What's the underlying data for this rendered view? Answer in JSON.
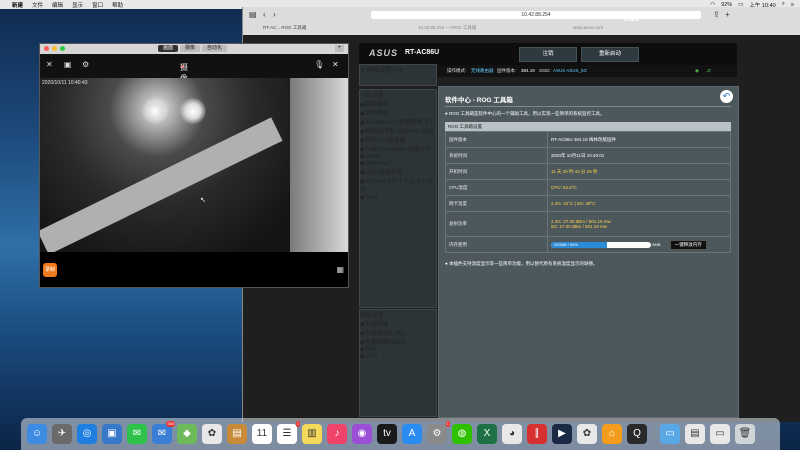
{
  "menubar": {
    "app_name": "新建",
    "items": [
      "文件",
      "编辑",
      "显示",
      "窗口",
      "帮助"
    ],
    "status": {
      "battery": "92%",
      "time": "上午 10:40"
    }
  },
  "camera_window": {
    "tabs": [
      "画面",
      "摄像",
      "自动化"
    ],
    "active_tab": 0,
    "title": "摄像机",
    "timestamp": "2020/10/11 10:40:43",
    "record_label": "录制"
  },
  "browser": {
    "url": "10.42.88.254",
    "tabs": [
      "RT-AC... ROG 工具箱",
      "10.42.88.254 — ROG 工具箱",
      "www.asus.com"
    ],
    "brand_text": "sct"
  },
  "router": {
    "model": "RT-AC86U",
    "logo": "ASUS",
    "header_buttons": [
      "注销",
      "重新启动"
    ],
    "status_bar": {
      "mode_label": "操作模式:",
      "mode_value": "无线路由器",
      "firmware_label": "固件版本:",
      "firmware_value": "384.19",
      "ssid_label": "SSID:",
      "ssid_value": "ASUS  ASUS_5G"
    },
    "sidebar": {
      "top_item": "网络设置向导",
      "general_title": "一般设置",
      "general_items": [
        {
          "icon": "network-map-icon",
          "label": "网络地图"
        },
        {
          "icon": "guest-icon",
          "label": "访客网络"
        },
        {
          "icon": "aiprotection-icon",
          "label": "AiProtection 智能网络卫士"
        },
        {
          "icon": "qos-icon",
          "label": "网络监控家 Adaptive QoS"
        },
        {
          "icon": "traffic-icon",
          "label": "网络LTU加速器"
        },
        {
          "icon": "traffic-analyzer-icon",
          "label": "Traffic Analyzer 流量分析"
        },
        {
          "icon": "game-icon",
          "label": "Game"
        },
        {
          "icon": "open-nat-icon",
          "label": "Open NAT"
        },
        {
          "icon": "usb-icon",
          "label": "USB 相关应用"
        },
        {
          "icon": "aicloud-icon",
          "label": "AiCloud 2.0 个人云 2.0 应用"
        },
        {
          "icon": "tools-icon",
          "label": "Tools"
        }
      ],
      "advanced_title": "高级设置",
      "advanced_items": [
        {
          "icon": "wireless-icon",
          "label": "无线网络"
        },
        {
          "icon": "lan-icon",
          "label": "内部网络(LAN)"
        },
        {
          "icon": "wan-icon",
          "label": "外部网络(WAN)"
        },
        {
          "icon": "ipv6-icon",
          "label": "IPv6"
        },
        {
          "icon": "vpn-icon",
          "label": "VPN"
        }
      ]
    },
    "main": {
      "title": "软件中心 - ROG 工具箱",
      "description": "● ROG 工具箱是软件中心的一个辅助工具，用以实现一些简单的系统监控工具。",
      "table_header": "ROG 工具箱设置",
      "rows": [
        {
          "key": "固件版本",
          "value": "RT-AC86U 384.19 梅林改版固件"
        },
        {
          "key": "系统时间",
          "value": "2020年 10月11日 10:40:01"
        },
        {
          "key": "开机时间",
          "value": "11 天 20 时 43 分 29 秒"
        },
        {
          "key": "CPU温度",
          "value": "CPU: 52.6°C"
        },
        {
          "key": "网卡温度",
          "value": "2.4G: 42°C  |  5G: 49°C"
        },
        {
          "key": "发射功率",
          "value": "2.4G: 27.00 dBm / 501.19 mw",
          "value2": "5G: 27.00 dBm / 501.19 mw"
        },
        {
          "key": "内存使用",
          "memory": {
            "text": "453MB / 56%",
            "fraction": 0.56,
            "right_text": "8MB",
            "button": "一键释放内存"
          }
        }
      ],
      "note": "● 本插件支持温度显示等一些简单功能，用以替代原有系统温度显示的缺憾。"
    }
  },
  "dock": {
    "apps": [
      {
        "name": "finder-icon",
        "color": "#3d8be2",
        "glyph": "☺"
      },
      {
        "name": "launchpad-icon",
        "color": "#6a6a6a",
        "glyph": "✈"
      },
      {
        "name": "safari-icon",
        "color": "#1e7fe0",
        "glyph": "◎"
      },
      {
        "name": "photos-icon",
        "color": "#3878c8",
        "glyph": "▣"
      },
      {
        "name": "messages-icon",
        "color": "#2fc24b",
        "glyph": "✉"
      },
      {
        "name": "mail-icon",
        "color": "#3a7fd5",
        "glyph": "✉",
        "badge": "284"
      },
      {
        "name": "maps-icon",
        "color": "#6dba5a",
        "glyph": "◆"
      },
      {
        "name": "photos2-icon",
        "color": "#e8e8e8",
        "glyph": "✿"
      },
      {
        "name": "notes-icon",
        "color": "#c98a3a",
        "glyph": "▤"
      },
      {
        "name": "calendar-icon",
        "color": "#ffffff",
        "glyph": "11"
      },
      {
        "name": "reminders-icon",
        "color": "#ffffff",
        "glyph": "☰",
        "badge": "1"
      },
      {
        "name": "stickies-icon",
        "color": "#f3d85a",
        "glyph": "▥"
      },
      {
        "name": "music-icon",
        "color": "#f0436a",
        "glyph": "♪"
      },
      {
        "name": "podcasts-icon",
        "color": "#9b4fd6",
        "glyph": "◉"
      },
      {
        "name": "tv-icon",
        "color": "#1a1a1a",
        "glyph": "tv"
      },
      {
        "name": "appstore-icon",
        "color": "#2a8cf0",
        "glyph": "A"
      },
      {
        "name": "settings-icon",
        "color": "#8a8a8a",
        "glyph": "⚙",
        "badge": "1"
      },
      {
        "name": "wechat-icon",
        "color": "#2dc100",
        "glyph": "◍"
      },
      {
        "name": "excel-icon",
        "color": "#1e7145",
        "glyph": "X"
      },
      {
        "name": "chrome-icon",
        "color": "#e8e8e8",
        "glyph": "◕"
      },
      {
        "name": "parallels-icon",
        "color": "#d63030",
        "glyph": "∥"
      },
      {
        "name": "quicktime-icon",
        "color": "#1b2a44",
        "glyph": "▶"
      },
      {
        "name": "baidu-icon",
        "color": "#e8e8e8",
        "glyph": "✿"
      },
      {
        "name": "home-icon",
        "color": "#f39c1e",
        "glyph": "⌂"
      },
      {
        "name": "proxy-icon",
        "color": "#2a2a2a",
        "glyph": "Q"
      },
      {
        "name": "folder-icon",
        "color": "#5aa7e6",
        "glyph": "▭"
      },
      {
        "name": "preview-icon",
        "color": "#e8e8e8",
        "glyph": "▤"
      },
      {
        "name": "screen-icon",
        "color": "#e8e8e8",
        "glyph": "▭"
      },
      {
        "name": "trash-icon",
        "color": "#cfd4d8",
        "glyph": "🗑"
      }
    ]
  }
}
